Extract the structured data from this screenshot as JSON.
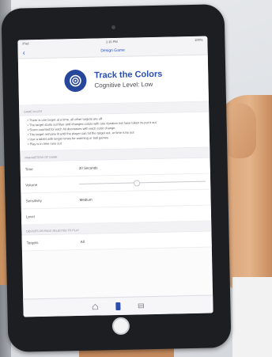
{
  "statusbar": {
    "left": "iPad",
    "time": "1:15 PM",
    "right": "100%"
  },
  "navbar": {
    "title": "Design Game",
    "back_glyph": "‹"
  },
  "game": {
    "title": "Track the Colors",
    "level": "Cognitive Level: Low",
    "icon": "target-icon",
    "accent": "#27479a"
  },
  "rules": {
    "header": "Game Rules",
    "items": [
      "• There is one target at a time, all other targets are off",
      "• The target starts out blue and changes colors with one duration not have taken its put it out",
      "• Score counted for each hit decreases with each color change",
      "• The target remains lit until the player can hit the target out, or time runs out",
      "• Use a tablet with longer times for warming or ball games",
      "• Play is in time runs out"
    ]
  },
  "parameters": {
    "header": "Parameters of Game",
    "time": {
      "label": "Time",
      "value": "30 Seconds"
    },
    "volume": {
      "label": "Volume",
      "level": 0.45
    },
    "sensitivity": {
      "label": "Sensitivity",
      "value": "Medium"
    },
    "level": {
      "label": "Level"
    }
  },
  "targets": {
    "header": "Devices or Pads Selected to Play",
    "label": "Targets",
    "value": "All"
  }
}
